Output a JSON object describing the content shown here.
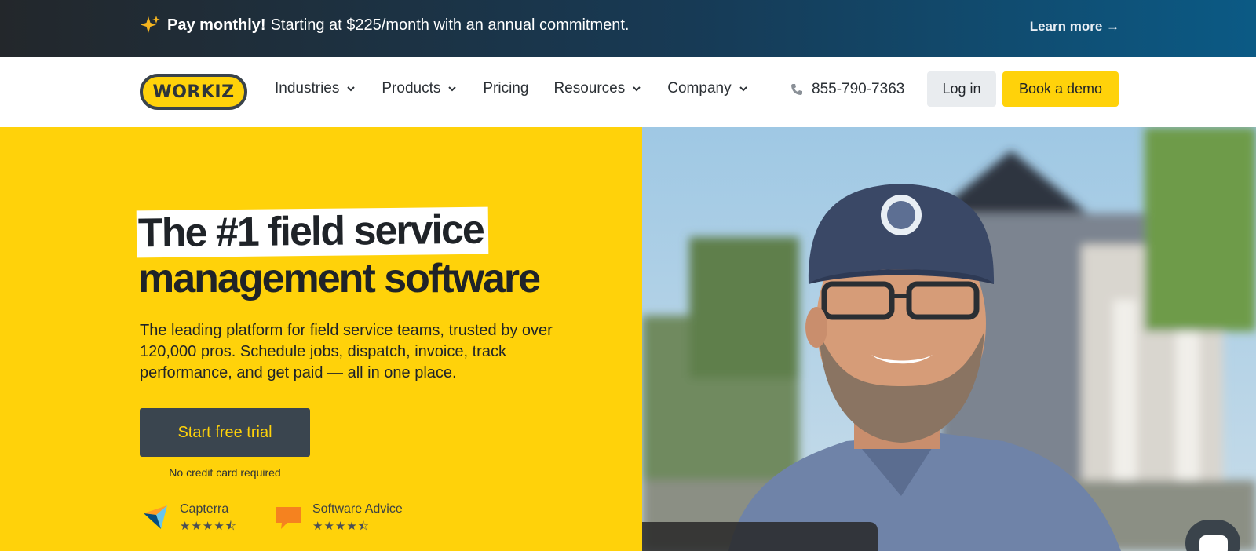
{
  "promo": {
    "bold": "Pay monthly!",
    "text": "Starting at $225/month with an annual commitment.",
    "link": "Learn more →",
    "icon": "sparkle-icon"
  },
  "nav": {
    "logo": "WORKIZ",
    "menu": [
      "Industries",
      "Products",
      "Pricing",
      "Resources",
      "Company"
    ],
    "phone": "855-790-7363",
    "login": "Log in",
    "demo": "Book a demo"
  },
  "hero": {
    "headline_line1": "The #1 field service",
    "headline_line2": "management software",
    "subtext": "The leading platform for field service teams, trusted by over 120,000 pros. Schedule jobs, dispatch, invoice, track performance, and get paid — all in one place.",
    "cta": "Start free trial",
    "cta_note": "No credit card required",
    "reviews": [
      {
        "name": "Capterra",
        "stars": "★★★★⯪",
        "icon": "capterra-icon"
      },
      {
        "name": "Software Advice",
        "stars": "★★★★⯪",
        "icon": "software-advice-icon"
      }
    ]
  },
  "colors": {
    "brand_yellow": "#ffd20a",
    "dark": "#3a454f"
  }
}
